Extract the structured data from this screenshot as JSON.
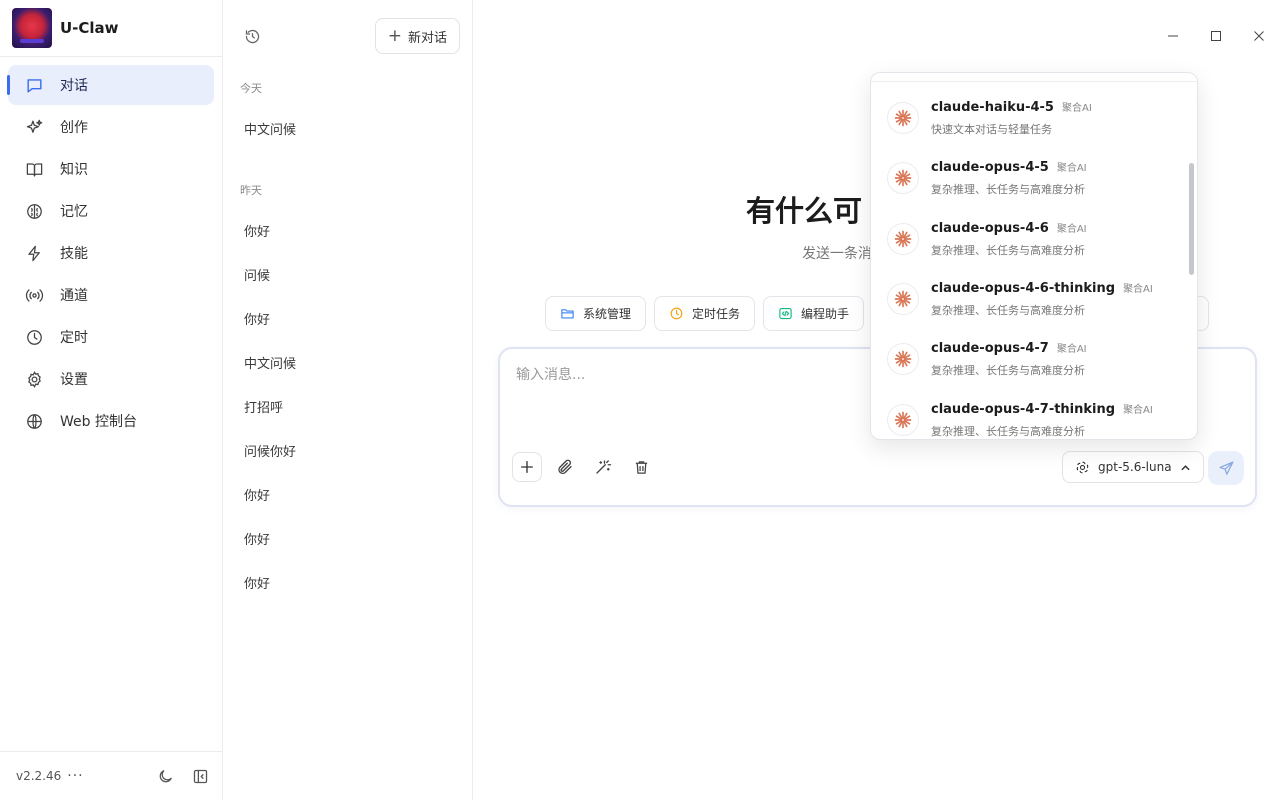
{
  "app": {
    "title": "U-Claw",
    "version": "v2.2.46"
  },
  "sidebar": {
    "items": [
      {
        "label": "对话",
        "icon": "chat-icon",
        "active": true
      },
      {
        "label": "创作",
        "icon": "sparkle-icon"
      },
      {
        "label": "知识",
        "icon": "book-icon"
      },
      {
        "label": "记忆",
        "icon": "brain-icon"
      },
      {
        "label": "技能",
        "icon": "lightning-icon"
      },
      {
        "label": "通道",
        "icon": "broadcast-icon"
      },
      {
        "label": "定时",
        "icon": "clock-icon"
      },
      {
        "label": "设置",
        "icon": "gear-icon"
      },
      {
        "label": "Web 控制台",
        "icon": "globe-icon"
      }
    ],
    "more": "···"
  },
  "history": {
    "new_chat_label": "新对话",
    "groups": [
      {
        "label": "今天",
        "items": [
          "中文问候"
        ]
      },
      {
        "label": "昨天",
        "items": [
          "你好",
          "问候",
          "你好",
          "中文问候",
          "打招呼",
          "问候你好",
          "你好",
          "你好",
          "你好"
        ]
      }
    ]
  },
  "main": {
    "welcome_title": "有什么可",
    "welcome_subtitle": "发送一条消",
    "chips": [
      {
        "label": "系统管理",
        "icon": "folder-icon",
        "color": "#3b82f6"
      },
      {
        "label": "定时任务",
        "icon": "clock-icon",
        "color": "#f59e0b"
      },
      {
        "label": "编程助手",
        "icon": "code-icon",
        "color": "#10b981"
      }
    ],
    "composer": {
      "placeholder": "输入消息...",
      "model": "gpt-5.6-luna"
    }
  },
  "model_dropdown": {
    "items": [
      {
        "name": "claude-haiku-4-5",
        "provider": "聚合AI",
        "desc": "快速文本对话与轻量任务"
      },
      {
        "name": "claude-opus-4-5",
        "provider": "聚合AI",
        "desc": "复杂推理、长任务与高难度分析"
      },
      {
        "name": "claude-opus-4-6",
        "provider": "聚合AI",
        "desc": "复杂推理、长任务与高难度分析"
      },
      {
        "name": "claude-opus-4-6-thinking",
        "provider": "聚合AI",
        "desc": "复杂推理、长任务与高难度分析"
      },
      {
        "name": "claude-opus-4-7",
        "provider": "聚合AI",
        "desc": "复杂推理、长任务与高难度分析"
      },
      {
        "name": "claude-opus-4-7-thinking",
        "provider": "聚合AI",
        "desc": "复杂推理、长任务与高难度分析"
      }
    ]
  },
  "colors": {
    "accent": "#3b6df0",
    "active_nav_bg": "#e9eefc",
    "claude_orange": "#d97757"
  }
}
